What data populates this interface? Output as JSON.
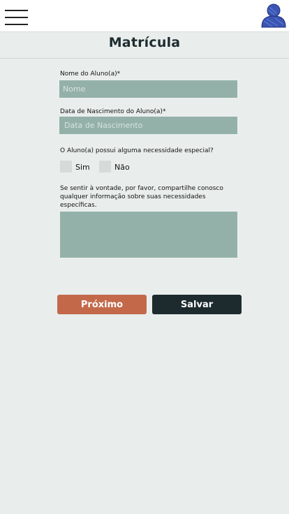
{
  "header": {
    "menu_icon": "hamburger-menu-icon",
    "avatar_icon": "user-avatar-icon",
    "avatar_color": "#3a55b4"
  },
  "page": {
    "title": "Matrícula"
  },
  "form": {
    "name_label": "Nome do Aluno(a)*",
    "name_placeholder": "Nome",
    "birth_label": "Data de Nascimento do Aluno(a)*",
    "birth_placeholder": "Data de Nascimento",
    "special_need_question": "O Aluno(a) possui alguma necessidade especial?",
    "option_yes": "Sim",
    "option_no": "Não",
    "details_label": "Se sentir à vontade, por favor, compartilhe conosco qualquer informação sobre suas necessidades específicas.",
    "details_value": ""
  },
  "actions": {
    "next_label": "Próximo",
    "save_label": "Salvar"
  },
  "colors": {
    "background": "#e9eeed",
    "input_fill": "#94b1a9",
    "next_button": "#c3694a",
    "save_button": "#1d2a2e"
  }
}
